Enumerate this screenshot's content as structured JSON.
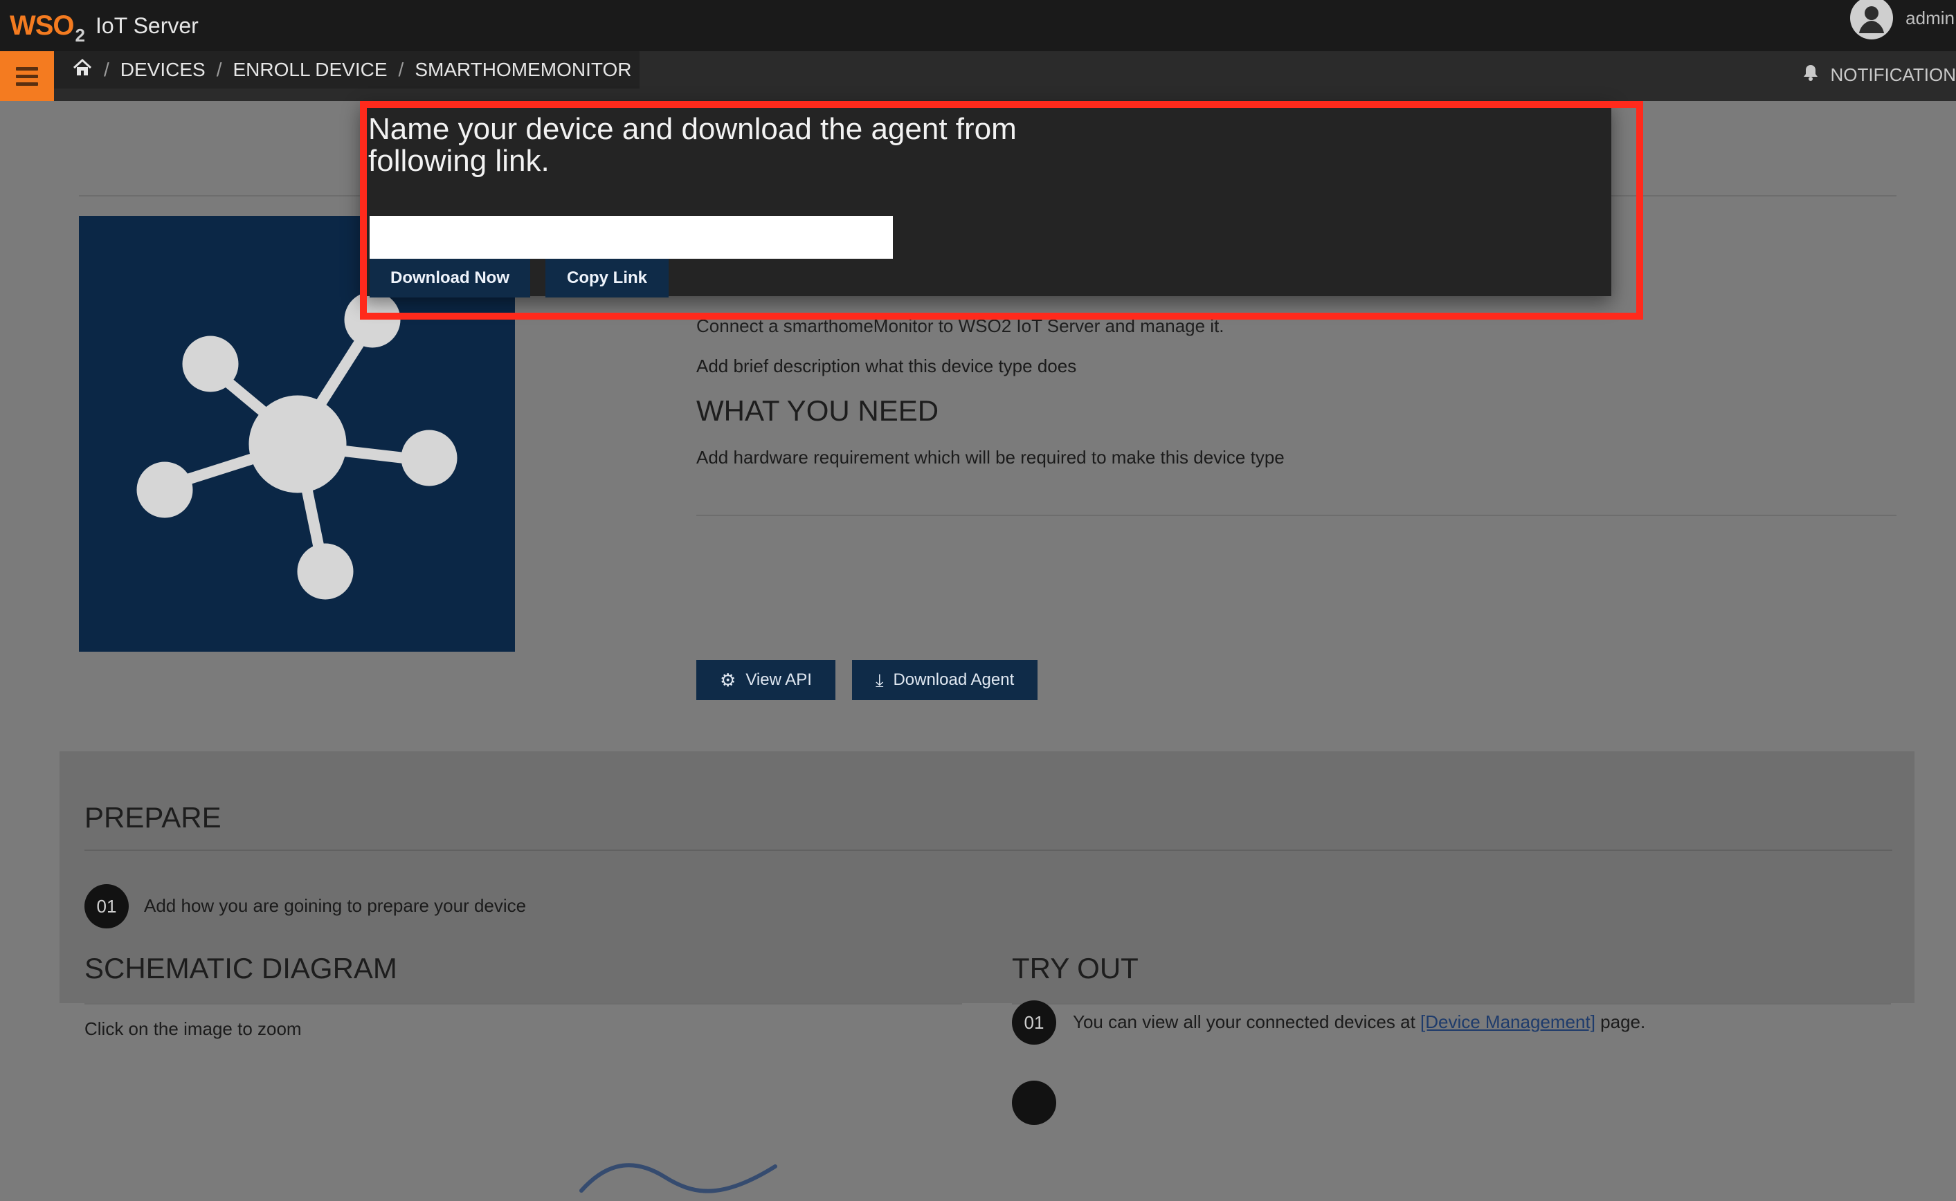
{
  "app": {
    "logo_text": "WSO",
    "logo_subscript": "2",
    "product_name": "IoT Server",
    "user_name": "admin",
    "notification_label": "NOTIFICATION"
  },
  "breadcrumb": {
    "items": [
      "DEVICES",
      "ENROLL DEVICE",
      "SMARTHOMEMONITOR"
    ],
    "separator": "/"
  },
  "modal": {
    "title": "Name your device and download the agent from following link.",
    "input_value": "",
    "buttons": {
      "download_now": "Download Now",
      "copy_link": "Copy Link"
    }
  },
  "device_page": {
    "description_partial": "Connect a smarthomeMonitor to WSO2 IoT Server and manage it.",
    "description": "Add brief description what this device type does",
    "what_you_need_title": "WHAT YOU NEED",
    "what_you_need_text": "Add hardware requirement which will be required to make this device type",
    "view_api_label": "View API",
    "download_agent_label": "Download Agent"
  },
  "prepare": {
    "title": "PREPARE",
    "steps": [
      {
        "num": "01",
        "text": "Add how you are goining to prepare your device"
      }
    ]
  },
  "schematic": {
    "title": "SCHEMATIC DIAGRAM",
    "hint": "Click on the image to zoom"
  },
  "tryout": {
    "title": "TRY OUT",
    "steps": [
      {
        "num": "01",
        "text_before": "You can view all your connected devices at ",
        "link_text": "[Device Management]",
        "text_after": " page."
      }
    ]
  },
  "icons": {
    "home": "home-icon",
    "bell": "bell-icon",
    "menu": "hamburger-icon",
    "user": "user-avatar-icon",
    "gear": "gear-icon",
    "download": "download-icon",
    "device_type": "iot-hub-icon"
  },
  "colors": {
    "top_bar": "#1a1a1a",
    "nav_bar": "#2b2b2b",
    "accent_orange": "#f47b20",
    "primary_button": "#0f2b48",
    "highlight_red": "#ff2a1c"
  }
}
